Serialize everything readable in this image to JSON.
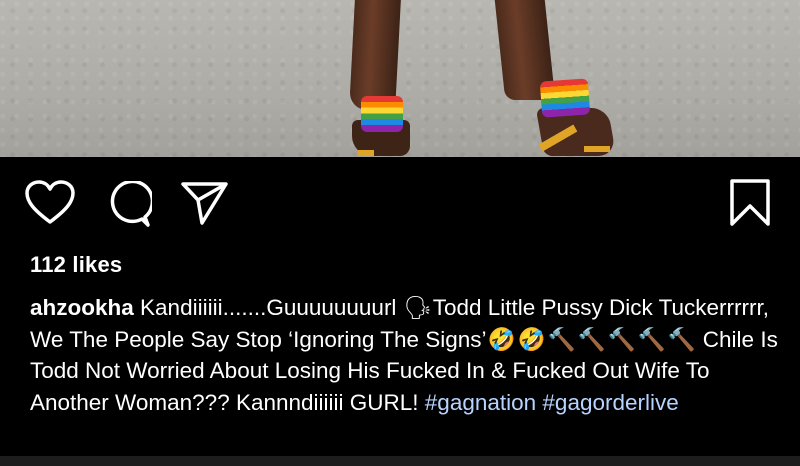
{
  "photo": {
    "alt_icon": "rainbow-cuffs-heels-photo"
  },
  "actions": {
    "like_icon": "heart-icon",
    "comment_icon": "comment-icon",
    "share_icon": "paper-plane-icon",
    "save_icon": "bookmark-icon"
  },
  "likes": "112 likes",
  "caption": {
    "username": "ahzookha",
    "text_1": " Kandiiiiii.......Guuuuuuuurl ",
    "emoji_speaking": "🗣",
    "text_2": "Todd Little Pussy Dick Tuckerrrrrr, We The People Say Stop ‘Ignoring The Signs’",
    "emoji_laugh": "🤣",
    "emoji_hammer": "🔨",
    "text_3": " Chile Is Todd Not Worried About Losing His Fucked In & Fucked Out Wife To Another Woman??? Kannndiiiiii GURL! ",
    "hashtag_1": "#gagnation",
    "hashtag_2": "#gagorderlive"
  }
}
